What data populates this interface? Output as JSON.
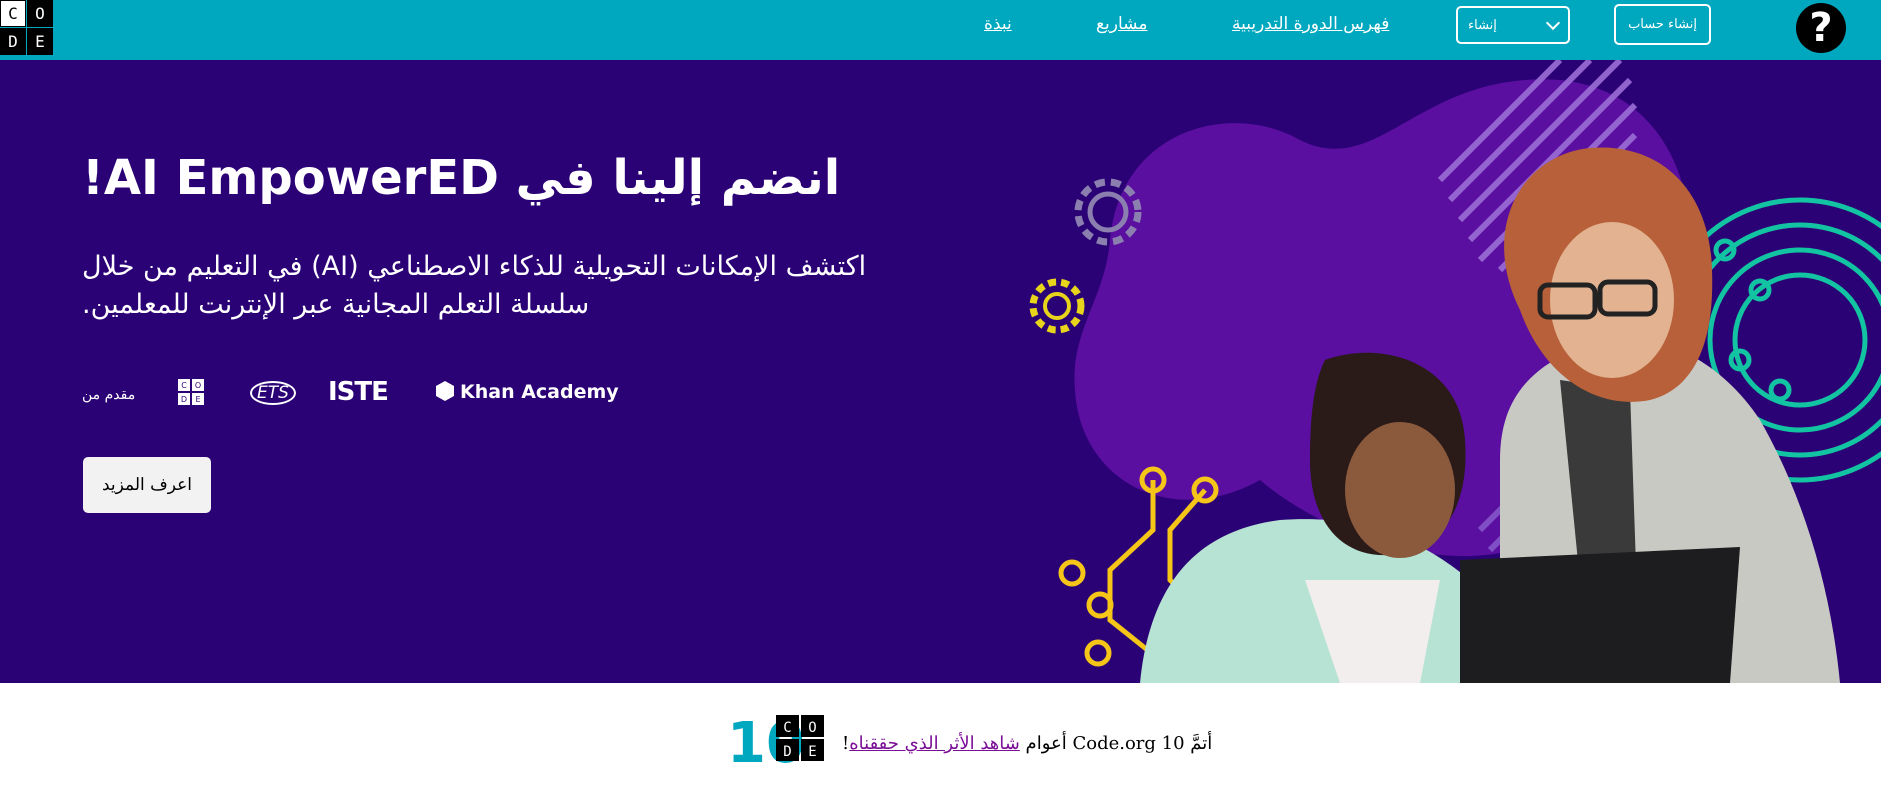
{
  "nav": {
    "logo_letters": [
      "C",
      "O",
      "D",
      "E"
    ],
    "links": {
      "about": "نبذة",
      "projects": "مشاريع",
      "course_catalog": "فهرس الدورة التدريبية"
    },
    "create_label": "إنشاء",
    "signup_label": "إنشاء حساب",
    "help_symbol": "?"
  },
  "hero": {
    "title": "انضم إلينا في AI EmpowerED!",
    "subtitle": "اكتشف الإمكانات التحويلية للذكاء الاصطناعي (AI) في التعليم من خلال سلسلة التعلم المجانية عبر الإنترنت للمعلمين.",
    "presented_by": "مقدم من",
    "partner_logos": {
      "code_letters": [
        "C",
        "O",
        "D",
        "E"
      ],
      "ets": "ETS",
      "iste": "ISTE",
      "khan": "Khan Academy"
    },
    "learn_more": "اعرف المزيد"
  },
  "banner": {
    "logo_number": "10",
    "logo_letters": [
      "C",
      "O",
      "D",
      "E"
    ],
    "text_before": "أتمَّ Code.org 10 أعوام ",
    "link": "شاهد الأثر الذي حققناه",
    "text_after": "!"
  },
  "colors": {
    "nav_bg": "#00a8bf",
    "hero_bg": "#2b0275",
    "blob": "#5a0fa0",
    "teal": "#13c4a3",
    "yellow": "#f5c518",
    "link": "#7b0f96"
  }
}
